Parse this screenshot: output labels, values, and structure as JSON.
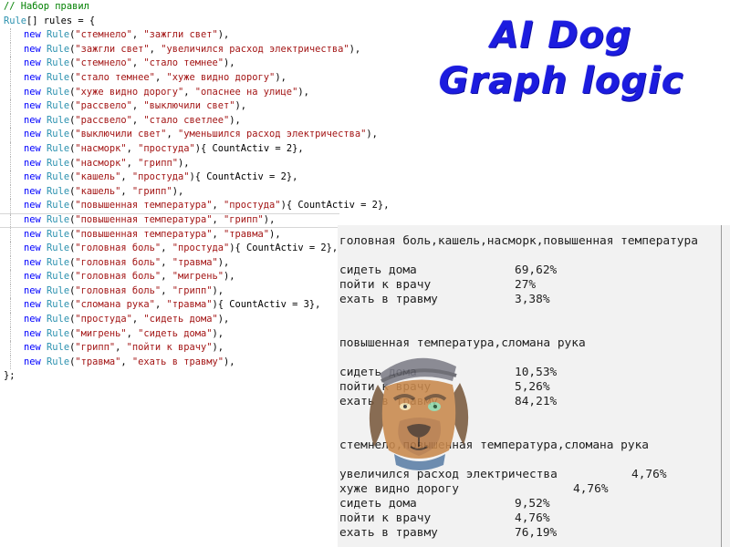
{
  "code": {
    "comment": "// Набор правил",
    "decl": {
      "type": "Rule",
      "rest": "[] rules = {"
    },
    "rules": [
      {
        "a": "стемнело",
        "b": "зажгли свет",
        "count": null
      },
      {
        "a": "зажгли свет",
        "b": "увеличился расход электричества",
        "count": null
      },
      {
        "a": "стемнело",
        "b": "стало темнее",
        "count": null
      },
      {
        "a": "стало темнее",
        "b": "хуже видно дорогу",
        "count": null
      },
      {
        "a": "хуже видно дорогу",
        "b": "опаснее на улице",
        "count": null
      },
      {
        "a": "рассвело",
        "b": "выключили свет",
        "count": null
      },
      {
        "a": "рассвело",
        "b": "стало светлее",
        "count": null
      },
      {
        "a": "выключили свет",
        "b": "уменьшился расход электричества",
        "count": null
      },
      {
        "a": "насморк",
        "b": "простуда",
        "count": "2"
      },
      {
        "a": "насморк",
        "b": "грипп",
        "count": null
      },
      {
        "a": "кашель",
        "b": "простуда",
        "count": "2"
      },
      {
        "a": "кашель",
        "b": "грипп",
        "count": null
      },
      {
        "a": "повышенная температура",
        "b": "простуда",
        "count": "2"
      },
      {
        "a": "повышенная температура",
        "b": "грипп",
        "count": null
      },
      {
        "a": "повышенная температура",
        "b": "травма",
        "count": null
      },
      {
        "a": "головная боль",
        "b": "простуда",
        "count": "2"
      },
      {
        "a": "головная боль",
        "b": "травма",
        "count": null
      },
      {
        "a": "головная боль",
        "b": "мигрень",
        "count": null
      },
      {
        "a": "головная боль",
        "b": "грипп",
        "count": null
      },
      {
        "a": "сломана рука",
        "b": "травма",
        "count": "3"
      },
      {
        "a": "простуда",
        "b": "сидеть дома",
        "count": null
      },
      {
        "a": "мигрень",
        "b": "сидеть дома",
        "count": null
      },
      {
        "a": "грипп",
        "b": "пойти к врачу",
        "count": null
      },
      {
        "a": "травма",
        "b": "ехать в травму",
        "count": null
      }
    ],
    "tokens": {
      "new": "new",
      "rule": "Rule",
      "count_prop": "CountActiv"
    },
    "close": "};"
  },
  "title": {
    "line1": "AI Dog",
    "line2": "Graph logic"
  },
  "console": {
    "blocks": [
      {
        "header": "головная боль,кашель,насморк,повышенная температура",
        "rows": [
          {
            "label": "сидеть дома",
            "value": "69,62%"
          },
          {
            "label": "пойти к врачу",
            "value": "27%"
          },
          {
            "label": "ехать в травму",
            "value": "3,38%"
          }
        ]
      },
      {
        "header": "повышенная температура,сломана рука",
        "rows": [
          {
            "label": "сидеть дома",
            "value": "10,53%"
          },
          {
            "label": "пойти к врачу",
            "value": "5,26%"
          },
          {
            "label": "ехать в травму",
            "value": "84,21%"
          }
        ]
      },
      {
        "header": "стемнело,повышенная температура,сломана рука",
        "rows": [
          {
            "label": "увеличился расход электричества",
            "value": "4,76%"
          },
          {
            "label": "хуже видно дорогу",
            "value": "4,76%"
          },
          {
            "label": "сидеть дома",
            "value": "9,52%"
          },
          {
            "label": "пойти к врачу",
            "value": "4,76%"
          },
          {
            "label": "ехать в травму",
            "value": "76,19%"
          }
        ]
      }
    ]
  },
  "colors": {
    "keyword": "#0000ff",
    "type": "#2b91af",
    "string": "#a31515",
    "comment": "#008000",
    "title": "#1c1cdf"
  },
  "mascot": {
    "icon": "dog-mascot-icon"
  }
}
